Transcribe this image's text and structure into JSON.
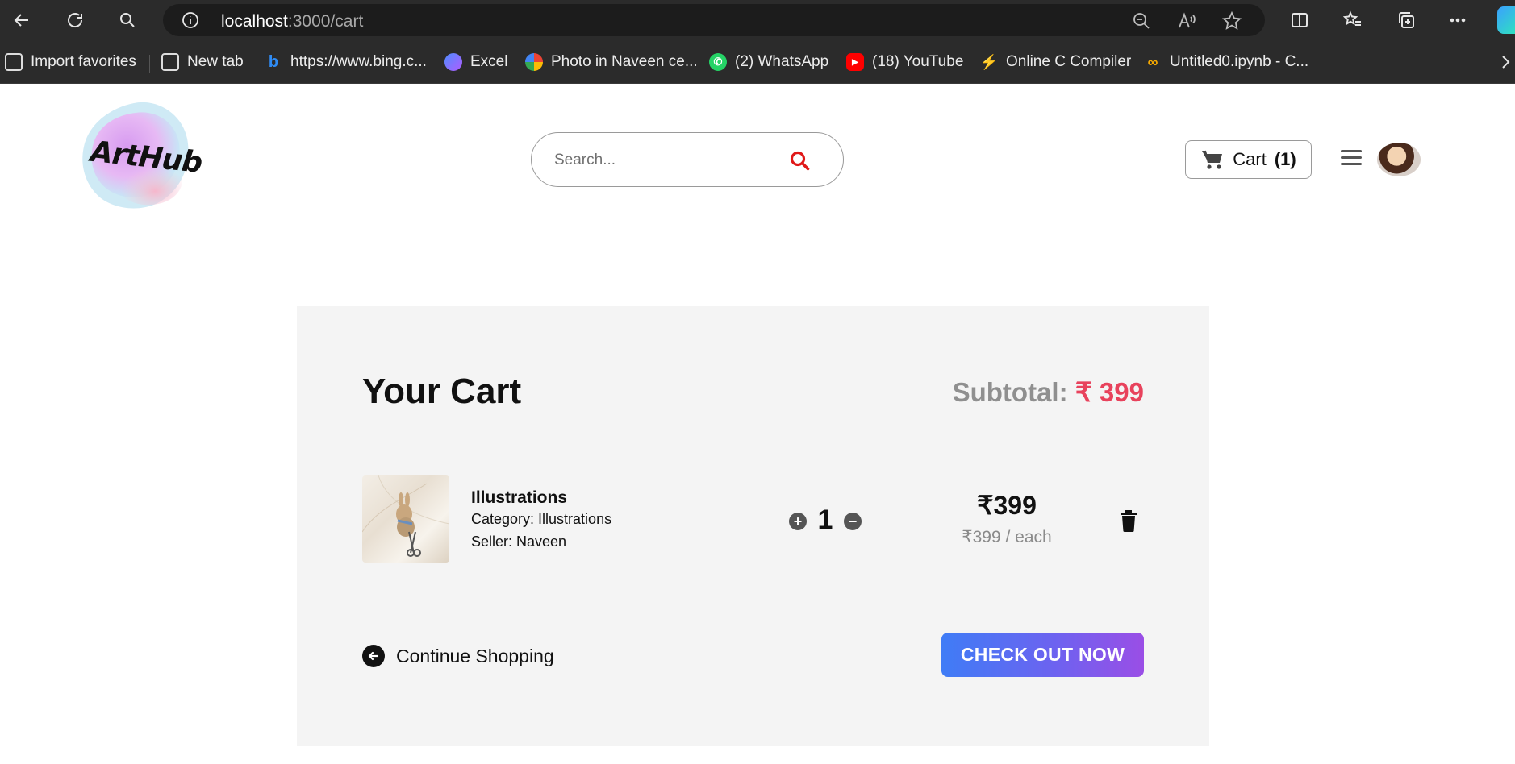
{
  "browser": {
    "url_host": "localhost",
    "url_path": ":3000/cart",
    "bookmarks": [
      {
        "label": "Import favorites",
        "icon": "import-icon"
      },
      {
        "label": "New tab",
        "icon": "new-tab-icon"
      },
      {
        "label": "https://www.bing.c...",
        "icon": "bing-icon"
      },
      {
        "label": "Excel",
        "icon": "excel-icon"
      },
      {
        "label": "Photo in Naveen ce...",
        "icon": "photos-icon"
      },
      {
        "label": "(2) WhatsApp",
        "icon": "whatsapp-icon"
      },
      {
        "label": "(18) YouTube",
        "icon": "youtube-icon"
      },
      {
        "label": "Online C Compiler",
        "icon": "compiler-icon"
      },
      {
        "label": "Untitled0.ipynb - C...",
        "icon": "colab-icon"
      }
    ]
  },
  "header": {
    "logo_text": "ArtHub",
    "search_placeholder": "Search...",
    "cart_label": "Cart",
    "cart_count": "(1)"
  },
  "cart": {
    "title": "Your Cart",
    "subtotal_label": "Subtotal:",
    "subtotal_amount": "₹ 399",
    "items": [
      {
        "name": "Illustrations",
        "category": "Category: Illustrations",
        "seller": "Seller: Naveen",
        "quantity": "1",
        "price": "₹399",
        "price_each": "₹399 / each"
      }
    ],
    "continue_label": "Continue Shopping",
    "checkout_label": "CHECK OUT NOW"
  },
  "colors": {
    "accent_red": "#e8425c",
    "checkout_gradient_start": "#3f7cf6",
    "checkout_gradient_end": "#9a4ee6",
    "panel_bg": "#f4f4f4"
  }
}
